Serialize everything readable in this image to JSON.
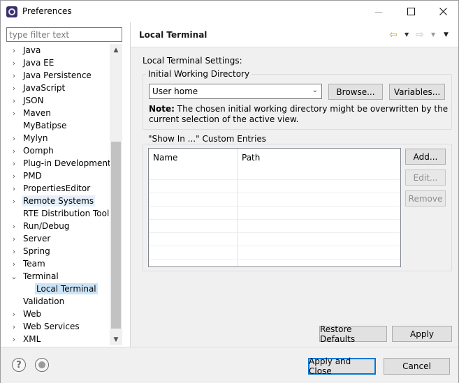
{
  "window": {
    "title": "Preferences",
    "min_glyph": "—",
    "max_glyph": "☐",
    "close_glyph": "✕"
  },
  "filter": {
    "placeholder": "type filter text",
    "value": ""
  },
  "tree": {
    "items": [
      {
        "label": "Java",
        "arrow": "›",
        "level": 0
      },
      {
        "label": "Java EE",
        "arrow": "›",
        "level": 0
      },
      {
        "label": "Java Persistence",
        "arrow": "›",
        "level": 0
      },
      {
        "label": "JavaScript",
        "arrow": "›",
        "level": 0
      },
      {
        "label": "JSON",
        "arrow": "›",
        "level": 0
      },
      {
        "label": "Maven",
        "arrow": "›",
        "level": 0
      },
      {
        "label": "MyBatipse",
        "arrow": "",
        "level": 0
      },
      {
        "label": "Mylyn",
        "arrow": "›",
        "level": 0
      },
      {
        "label": "Oomph",
        "arrow": "›",
        "level": 0
      },
      {
        "label": "Plug-in Development",
        "arrow": "›",
        "level": 0
      },
      {
        "label": "PMD",
        "arrow": "›",
        "level": 0
      },
      {
        "label": "PropertiesEditor",
        "arrow": "›",
        "level": 0
      },
      {
        "label": "Remote Systems",
        "arrow": "›",
        "level": 0,
        "state": "hover"
      },
      {
        "label": "RTE Distribution Tool",
        "arrow": "",
        "level": 0
      },
      {
        "label": "Run/Debug",
        "arrow": "›",
        "level": 0
      },
      {
        "label": "Server",
        "arrow": "›",
        "level": 0
      },
      {
        "label": "Spring",
        "arrow": "›",
        "level": 0
      },
      {
        "label": "Team",
        "arrow": "›",
        "level": 0
      },
      {
        "label": "Terminal",
        "arrow": "⌄",
        "level": 0
      },
      {
        "label": "Local Terminal",
        "arrow": "",
        "level": 1,
        "state": "selected"
      },
      {
        "label": "Validation",
        "arrow": "",
        "level": 0
      },
      {
        "label": "Web",
        "arrow": "›",
        "level": 0
      },
      {
        "label": "Web Services",
        "arrow": "›",
        "level": 0
      },
      {
        "label": "XML",
        "arrow": "›",
        "level": 0
      }
    ],
    "scroll_up": "▲",
    "scroll_down": "▼"
  },
  "page": {
    "title": "Local Terminal",
    "nav": {
      "back": "⇦",
      "forward": "⇨",
      "dropdown": "▼",
      "menu": "▼"
    },
    "settings_label": "Local Terminal Settings:",
    "working_dir": {
      "group_title": "Initial Working Directory",
      "combo_value": "User home",
      "combo_chevron": "⌄",
      "browse_label": "Browse...",
      "variables_label": "Variables...",
      "note_prefix": "Note:",
      "note_text": " The chosen initial working directory might be overwritten by the current selection of the active view."
    },
    "custom_entries": {
      "group_title": "\"Show In ...\" Custom Entries",
      "columns": [
        "Name",
        "Path"
      ],
      "rows": [],
      "add_label": "Add...",
      "edit_label": "Edit...",
      "remove_label": "Remove"
    },
    "restore_defaults_label": "Restore Defaults",
    "apply_label": "Apply"
  },
  "footer": {
    "help_glyph": "?",
    "apply_close_label": "Apply and Close",
    "cancel_label": "Cancel"
  },
  "colors": {
    "selection": "#cce4f7",
    "hover": "#e5f0fb",
    "default_button_border": "#0078d7",
    "panel_bg": "#f0f0f0"
  }
}
